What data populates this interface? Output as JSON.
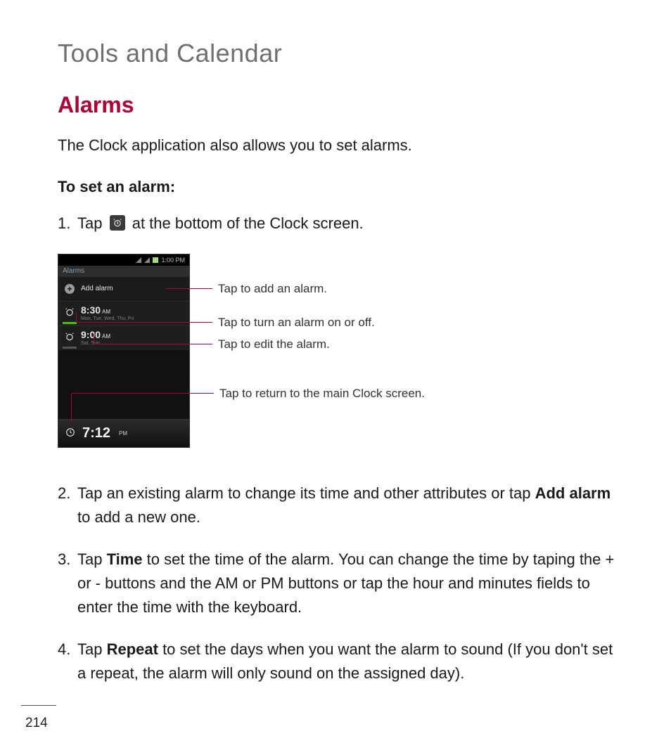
{
  "chapter_title": "Tools and Calendar",
  "section_title": "Alarms",
  "intro": "The Clock application also allows you to set alarms.",
  "subheading": "To set an alarm:",
  "step1": {
    "num": "1.",
    "pre": "Tap ",
    "icon_name": "alarm-clock-icon",
    "post": " at the bottom of the Clock screen."
  },
  "screenshot": {
    "statusbar_time": "1:00 PM",
    "header": "Alarms",
    "add_label": "Add alarm",
    "alarm1": {
      "time": "8:30",
      "ampm": "AM",
      "days": "Mon, Tue, Wed, Thu, Fri"
    },
    "alarm2": {
      "time": "9:00",
      "ampm": "AM",
      "days": "Sat, Sun"
    },
    "footer_time": "7:12",
    "footer_ampm": "PM"
  },
  "callouts": {
    "add": "Tap to add an alarm.",
    "toggle": "Tap to turn an alarm on or off.",
    "edit": "Tap to edit the alarm.",
    "back": "Tap to return to the main Clock screen."
  },
  "step2": {
    "num": "2.",
    "text_before_bold": "Tap an existing alarm to change its time and other attributes or tap ",
    "bold": "Add alarm",
    "text_after_bold": " to add a new one."
  },
  "step3": {
    "num": "3.",
    "text_before_bold": "Tap ",
    "bold": "Time",
    "text_after_bold": " to set the time of the alarm. You can change the time by taping the + or - buttons and the AM or PM buttons or tap the hour and minutes fields to enter the time with the keyboard."
  },
  "step4": {
    "num": "4.",
    "text_before_bold": "Tap ",
    "bold": "Repeat",
    "text_after_bold": " to set the days when you want the alarm to sound (If you don't set a repeat, the alarm will only sound on the assigned day)."
  },
  "page_number": "214"
}
